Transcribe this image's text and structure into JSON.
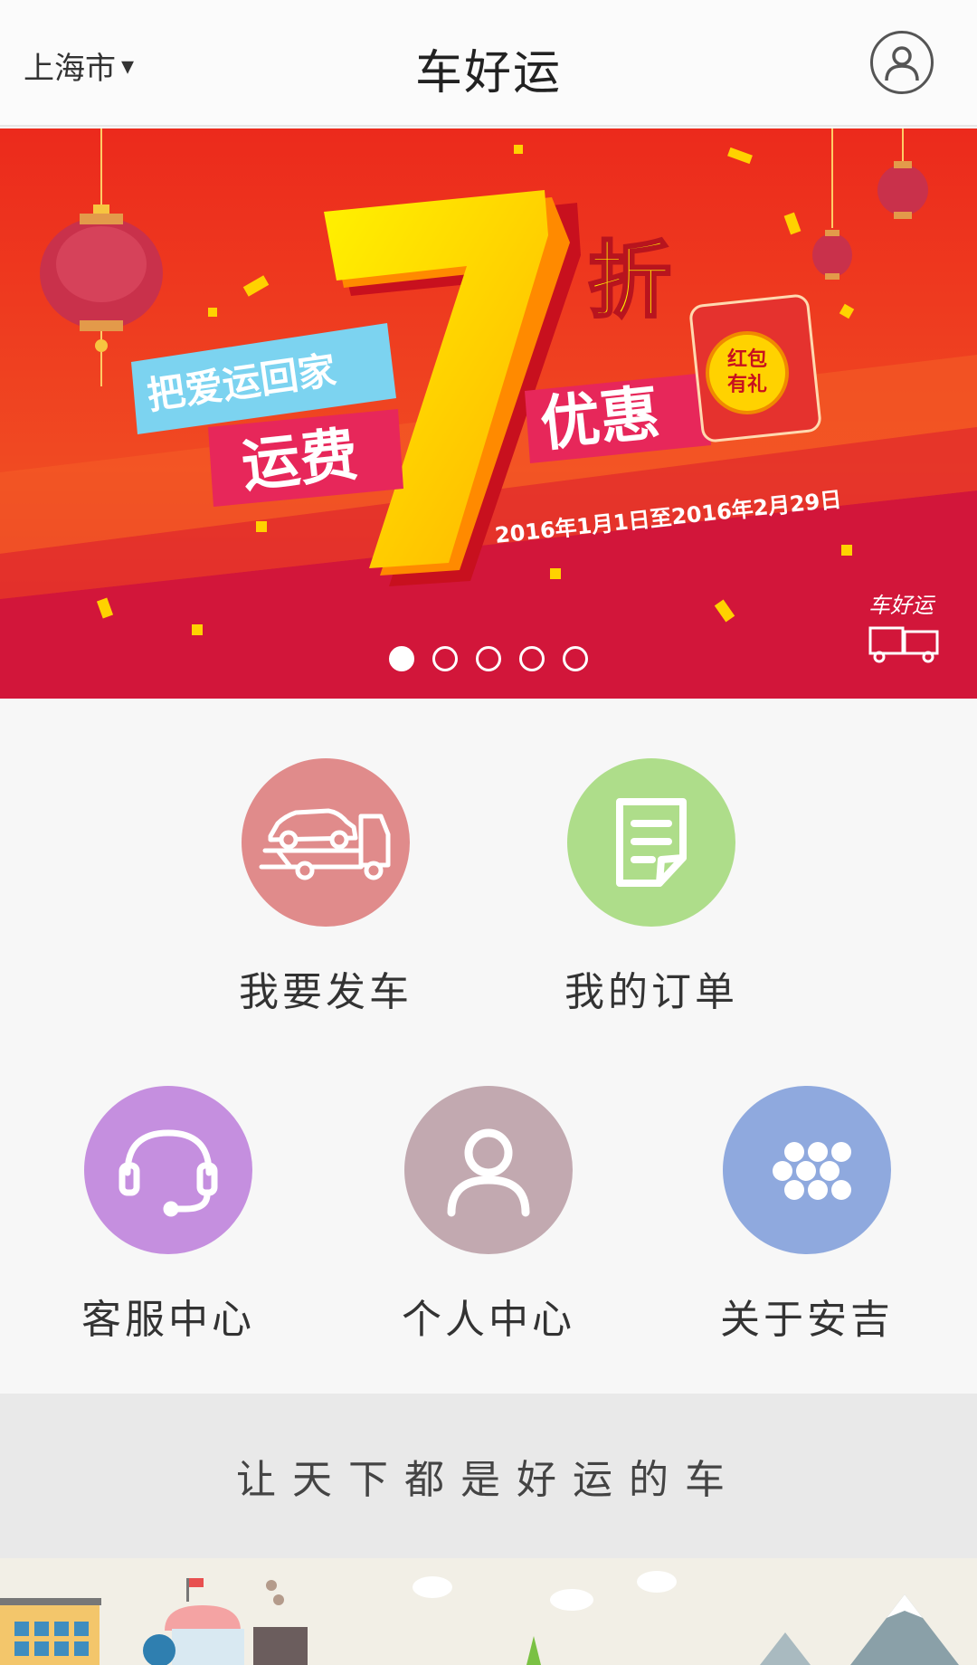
{
  "header": {
    "city": "上海市",
    "city_caret": "▾",
    "title": "车好运"
  },
  "banner": {
    "line1": "把爱运回家",
    "line2": "运费",
    "big_number": "7",
    "zhe": "折",
    "youhui": "优惠",
    "hongbao": "红包有礼",
    "hongbao_line1": "红包",
    "hongbao_line2": "有礼",
    "date_range": "2016年1月1日至2016年2月29日",
    "brand": "车好运",
    "slide_count": 5,
    "active_slide": 1
  },
  "menu": {
    "items": [
      {
        "label": "我要发车",
        "icon": "car-carrier-icon",
        "color": "#e08b8b"
      },
      {
        "label": "我的订单",
        "icon": "order-document-icon",
        "color": "#aedd8a"
      },
      {
        "label": "客服中心",
        "icon": "headset-icon",
        "color": "#c58fdf"
      },
      {
        "label": "个人中心",
        "icon": "person-icon",
        "color": "#c2a9b0"
      },
      {
        "label": "关于安吉",
        "icon": "dots-grid-icon",
        "color": "#8fa9de"
      }
    ]
  },
  "slogan": "让天下都是好运的车",
  "colors": {
    "banner_red": "#e8262c",
    "accent_yellow": "#ffd200"
  }
}
